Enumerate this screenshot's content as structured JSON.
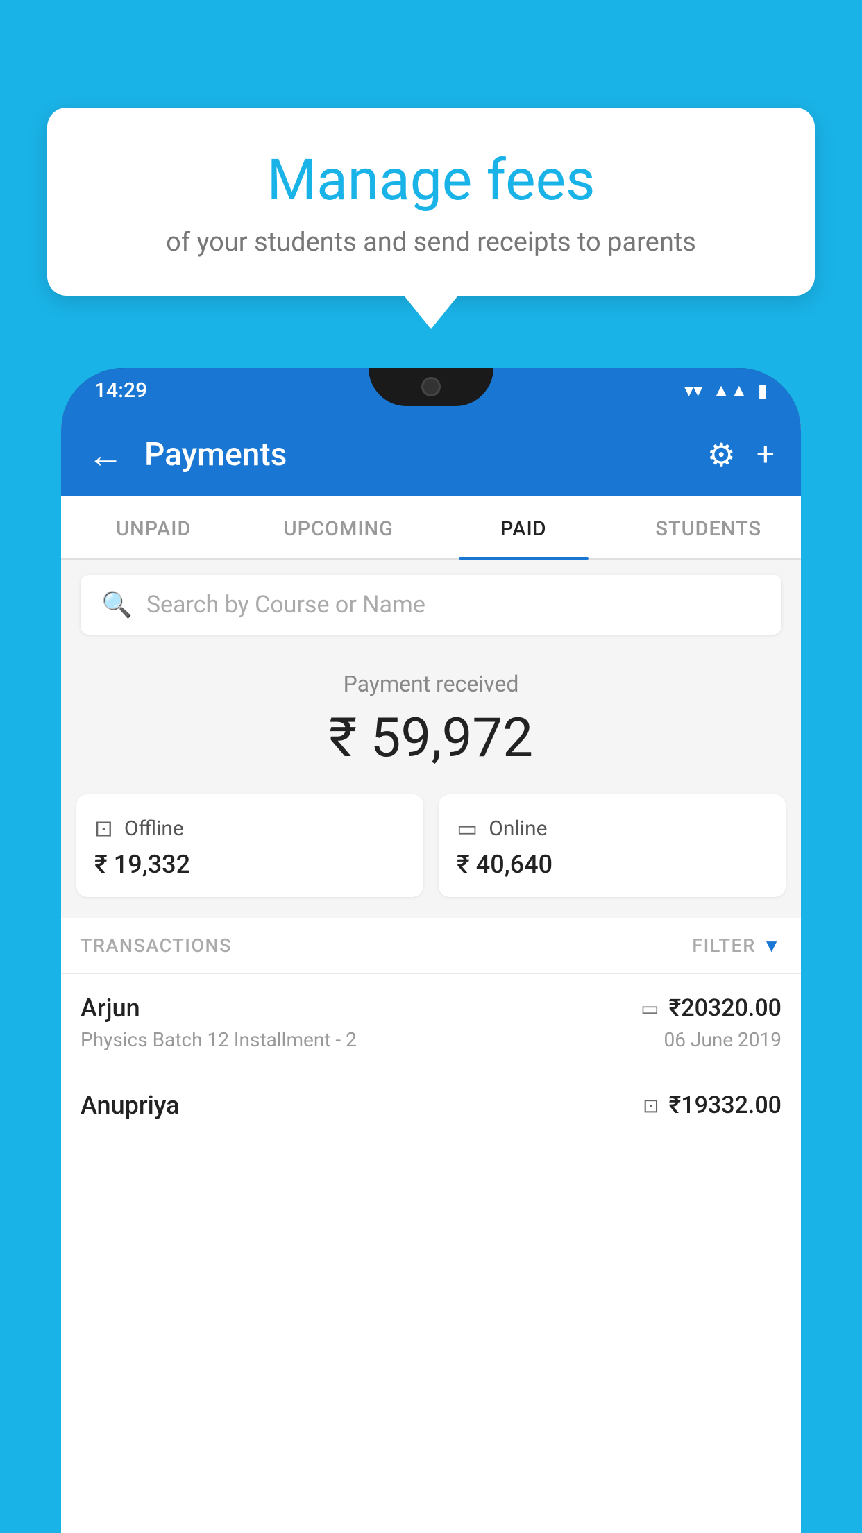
{
  "page": {
    "background_color": "#1ab3e8"
  },
  "speech_bubble": {
    "title": "Manage fees",
    "subtitle": "of your students and send receipts to parents"
  },
  "status_bar": {
    "time": "14:29",
    "wifi_icon": "▼",
    "signal_icon": "▲",
    "battery_icon": "▮"
  },
  "app_bar": {
    "back_icon": "←",
    "title": "Payments",
    "settings_icon": "⚙",
    "add_icon": "+"
  },
  "tabs": [
    {
      "label": "UNPAID",
      "active": false
    },
    {
      "label": "UPCOMING",
      "active": false
    },
    {
      "label": "PAID",
      "active": true
    },
    {
      "label": "STUDENTS",
      "active": false
    }
  ],
  "search": {
    "placeholder": "Search by Course or Name",
    "icon": "🔍"
  },
  "payment": {
    "label": "Payment received",
    "amount": "₹ 59,972",
    "cards": [
      {
        "type": "Offline",
        "icon": "💳",
        "amount": "₹ 19,332"
      },
      {
        "type": "Online",
        "icon": "💳",
        "amount": "₹ 40,640"
      }
    ]
  },
  "transactions": {
    "header_label": "TRANSACTIONS",
    "filter_label": "FILTER",
    "filter_icon": "▼",
    "rows": [
      {
        "name": "Arjun",
        "description": "Physics Batch 12 Installment - 2",
        "amount": "₹20320.00",
        "date": "06 June 2019",
        "mode_icon": "💳"
      },
      {
        "name": "Anupriya",
        "description": "",
        "amount": "₹19332.00",
        "date": "",
        "mode_icon": "💳"
      }
    ]
  }
}
